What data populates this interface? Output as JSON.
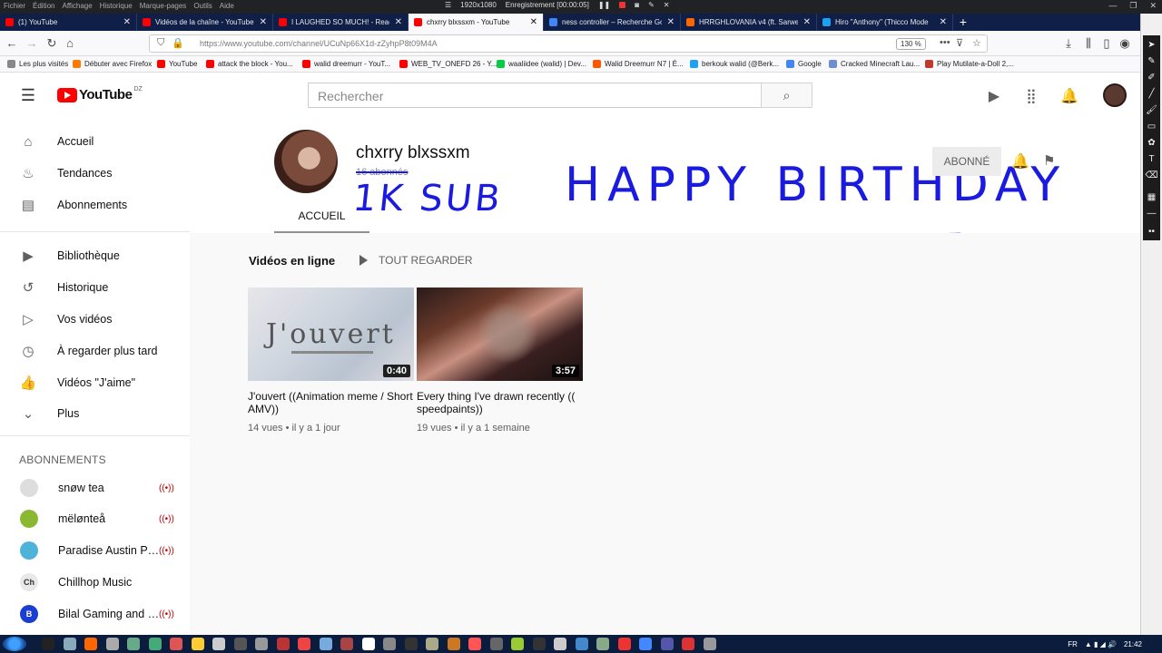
{
  "window": {
    "menu": [
      "Fichier",
      "Édition",
      "Affichage",
      "Historique",
      "Marque-pages",
      "Outils",
      "Aide"
    ],
    "resolution": "1920x1080",
    "recording": "Enregistrement [00:00:05]"
  },
  "tabs": [
    {
      "label": "(1) YouTube",
      "color": "#ff0000",
      "active": false
    },
    {
      "label": "Vidéos de la chaîne - YouTube",
      "color": "#ff0000",
      "active": false
    },
    {
      "label": "I LAUGHED SO MUCH! - Reacting",
      "color": "#ff0000",
      "active": false
    },
    {
      "label": "chxrry blxssxm - YouTube",
      "color": "#ff0000",
      "active": true
    },
    {
      "label": "ness controller – Recherche Go",
      "color": "#4285f4",
      "active": false
    },
    {
      "label": "HRRGHLOVANIA v4 (ft. Sarwe",
      "color": "#ff6600",
      "active": false
    },
    {
      "label": "Hiro \"Anthony\" (Thicco Mode",
      "color": "#1da1f2",
      "active": false
    }
  ],
  "address": {
    "url": "https://www.youtube.com/channel/UCuNp66X1d-zZyhpP8t09M4A",
    "zoom": "130 %"
  },
  "bookmarks": [
    {
      "label": "Les plus visités",
      "color": "#888888"
    },
    {
      "label": "Débuter avec Firefox",
      "color": "#ff7a00"
    },
    {
      "label": "YouTube",
      "color": "#ff0000"
    },
    {
      "label": "attack the block - You...",
      "color": "#ff0000"
    },
    {
      "label": "walid dreemurr - YouT...",
      "color": "#ff0000"
    },
    {
      "label": "WEB_TV_ONEFD 26 - Y...",
      "color": "#ff0000"
    },
    {
      "label": "waaliidee (walid) | Dev...",
      "color": "#05cc47"
    },
    {
      "label": "Walid Dreemurr N7 | É...",
      "color": "#ff5500"
    },
    {
      "label": "berkouk walid (@Berk...",
      "color": "#1da1f2"
    },
    {
      "label": "Google",
      "color": "#4285f4"
    },
    {
      "label": "Cracked Minecraft Lau...",
      "color": "#6b8fd0"
    },
    {
      "label": "Play Mutilate-a-Doll 2,...",
      "color": "#c0392b"
    }
  ],
  "youtube": {
    "logo_text": "YouTube",
    "country": "DZ",
    "search_placeholder": "Rechercher"
  },
  "sidebar": {
    "items": [
      {
        "label": "Accueil",
        "icon": "home-icon",
        "glyph": "⌂"
      },
      {
        "label": "Tendances",
        "icon": "flame-icon",
        "glyph": "♨"
      },
      {
        "label": "Abonnements",
        "icon": "subscriptions-icon",
        "glyph": "▤"
      },
      {
        "label": "Bibliothèque",
        "icon": "library-icon",
        "glyph": "▶"
      },
      {
        "label": "Historique",
        "icon": "history-icon",
        "glyph": "↺"
      },
      {
        "label": "Vos vidéos",
        "icon": "your-videos-icon",
        "glyph": "▷"
      },
      {
        "label": "À regarder plus tard",
        "icon": "watch-later-icon",
        "glyph": "◷"
      },
      {
        "label": "Vidéos \"J'aime\"",
        "icon": "thumbs-up-icon",
        "glyph": "👍"
      },
      {
        "label": "Plus",
        "icon": "chevron-down-icon",
        "glyph": "⌄"
      }
    ],
    "subscriptions_header": "ABONNEMENTS",
    "subscriptions": [
      {
        "label": "snøw tea",
        "avatar": "#dddddd",
        "mark": "",
        "live": true
      },
      {
        "label": "mëlønteå",
        "avatar": "#8ab833",
        "mark": "",
        "live": true
      },
      {
        "label": "Paradise Austin Pe...",
        "avatar": "#4fb3d9",
        "mark": "",
        "live": true
      },
      {
        "label": "Chillhop Music",
        "avatar": "#e8e8e8",
        "mark": "Ch",
        "live": false
      },
      {
        "label": "Bilal Gaming and V...",
        "avatar": "#1a3fd0",
        "mark": "B",
        "live": true
      }
    ]
  },
  "channel": {
    "name": "chxrry blxssxm",
    "subscribers": "16 abonnés",
    "tab": "ACCUEIL",
    "subscribe_label": "ABONNÉ",
    "handwritten_sub": "1K SUB",
    "handwritten_hbd": "HAPPY BIRTHDAY"
  },
  "section": {
    "title": "Vidéos en ligne",
    "play_all": "TOUT REGARDER"
  },
  "videos": [
    {
      "title": "J'ouvert ((Animation meme / Short AMV))",
      "duration": "0:40",
      "meta": "14 vues • il y a 1 jour",
      "thumb_text": "J'ouvert"
    },
    {
      "title": "Every thing I've drawn recently (( speedpaints))",
      "duration": "3:57",
      "meta": "19 vues • il y a 1 semaine",
      "thumb_text": ""
    }
  ],
  "taskbar": {
    "lang": "FR",
    "time": "21:42"
  }
}
